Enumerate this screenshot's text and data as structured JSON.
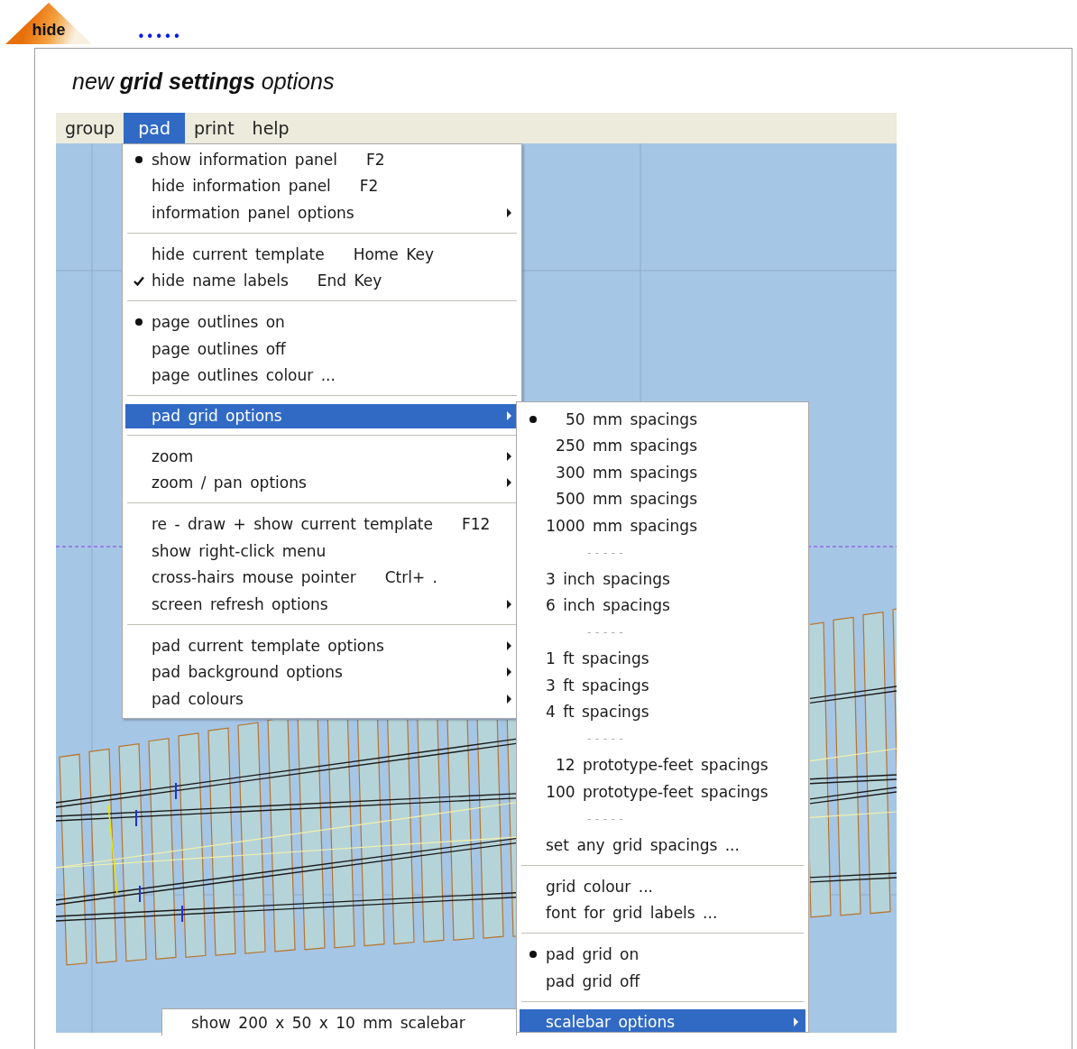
{
  "logo_button": {
    "label": "hide"
  },
  "dots": "•••••",
  "heading": "new **grid settings** options",
  "menubar": [
    {
      "label": "group",
      "selected": false
    },
    {
      "label": "pad",
      "selected": true
    },
    {
      "label": "print",
      "selected": false
    },
    {
      "label": "help",
      "selected": false
    }
  ],
  "pad_menu": {
    "groups": [
      [
        {
          "text": "show information panel",
          "bullet": true,
          "checked": false,
          "shortcut": "F2",
          "submenu": false,
          "selected": false
        },
        {
          "text": "hide information panel",
          "bullet": false,
          "checked": false,
          "shortcut": "F2",
          "submenu": false,
          "selected": false
        },
        {
          "text": "information panel options",
          "bullet": false,
          "checked": false,
          "submenu": true,
          "selected": false
        }
      ],
      [
        {
          "text": "hide current template",
          "bullet": false,
          "checked": false,
          "shortcut": "Home Key",
          "submenu": false,
          "selected": false
        },
        {
          "text": "hide name labels",
          "bullet": false,
          "checked": true,
          "shortcut": "End Key",
          "submenu": false,
          "selected": false
        }
      ],
      [
        {
          "text": "page outlines on",
          "bullet": true,
          "checked": false,
          "submenu": false,
          "selected": false
        },
        {
          "text": "page outlines off",
          "bullet": false,
          "checked": false,
          "submenu": false,
          "selected": false
        },
        {
          "text": "page outlines colour ...",
          "bullet": false,
          "checked": false,
          "submenu": false,
          "selected": false
        }
      ],
      [
        {
          "text": "pad grid options",
          "bullet": false,
          "checked": false,
          "submenu": true,
          "selected": true
        }
      ],
      [
        {
          "text": "zoom",
          "bullet": false,
          "checked": false,
          "submenu": true,
          "selected": false
        },
        {
          "text": "zoom / pan options",
          "bullet": false,
          "checked": false,
          "submenu": true,
          "selected": false
        }
      ],
      [
        {
          "text": "re - draw + show current template",
          "bullet": false,
          "checked": false,
          "shortcut": "F12",
          "submenu": false,
          "selected": false
        },
        {
          "text": "show right-click menu",
          "bullet": false,
          "checked": false,
          "submenu": false,
          "selected": false
        },
        {
          "text": "cross-hairs mouse pointer",
          "bullet": false,
          "checked": false,
          "shortcut": "Ctrl+ .",
          "submenu": false,
          "selected": false
        },
        {
          "text": "screen refresh options",
          "bullet": false,
          "checked": false,
          "submenu": true,
          "selected": false
        }
      ],
      [
        {
          "text": "pad current template options",
          "bullet": false,
          "checked": false,
          "submenu": true,
          "selected": false
        },
        {
          "text": "pad background options",
          "bullet": false,
          "checked": false,
          "submenu": true,
          "selected": false
        },
        {
          "text": "pad colours",
          "bullet": false,
          "checked": false,
          "submenu": true,
          "selected": false
        }
      ]
    ]
  },
  "grid_submenu": [
    {
      "kind": "numbered",
      "number": "50",
      "text": "mm spacings",
      "bullet": true,
      "submenu": false,
      "selected": false
    },
    {
      "kind": "numbered",
      "number": "250",
      "text": "mm spacings",
      "bullet": false,
      "submenu": false,
      "selected": false
    },
    {
      "kind": "numbered",
      "number": "300",
      "text": "mm spacings",
      "bullet": false,
      "submenu": false,
      "selected": false
    },
    {
      "kind": "numbered",
      "number": "500",
      "text": "mm spacings",
      "bullet": false,
      "submenu": false,
      "selected": false
    },
    {
      "kind": "numbered",
      "number": "1000",
      "text": "mm spacings",
      "bullet": false,
      "submenu": false,
      "selected": false
    },
    {
      "kind": "dashes",
      "text": "- - - - -"
    },
    {
      "kind": "item",
      "text": "3 inch spacings",
      "bullet": false,
      "submenu": false,
      "selected": false
    },
    {
      "kind": "item",
      "text": "6 inch spacings",
      "bullet": false,
      "submenu": false,
      "selected": false
    },
    {
      "kind": "dashes",
      "text": "- - - - -"
    },
    {
      "kind": "item",
      "text": "1 ft spacings",
      "bullet": false,
      "submenu": false,
      "selected": false
    },
    {
      "kind": "item",
      "text": "3 ft spacings",
      "bullet": false,
      "submenu": false,
      "selected": false
    },
    {
      "kind": "item",
      "text": "4 ft spacings",
      "bullet": false,
      "submenu": false,
      "selected": false
    },
    {
      "kind": "dashes",
      "text": "- - - - -"
    },
    {
      "kind": "numbered",
      "number": "12",
      "text": "prototype-feet spacings",
      "bullet": false,
      "submenu": false,
      "selected": false
    },
    {
      "kind": "numbered",
      "number": "100",
      "text": "prototype-feet spacings",
      "bullet": false,
      "submenu": false,
      "selected": false
    },
    {
      "kind": "dashes",
      "text": "- - - - -"
    },
    {
      "kind": "item",
      "text": "set any grid spacings ...",
      "bullet": false,
      "submenu": false,
      "selected": false
    },
    {
      "kind": "separator"
    },
    {
      "kind": "item",
      "text": "grid colour ...",
      "bullet": false,
      "submenu": false,
      "selected": false
    },
    {
      "kind": "item",
      "text": "font for grid labels ...",
      "bullet": false,
      "submenu": false,
      "selected": false
    },
    {
      "kind": "separator"
    },
    {
      "kind": "item",
      "text": "pad grid on",
      "bullet": true,
      "submenu": false,
      "selected": false
    },
    {
      "kind": "item",
      "text": "pad grid off",
      "bullet": false,
      "submenu": false,
      "selected": false
    },
    {
      "kind": "separator"
    },
    {
      "kind": "item",
      "text": "scalebar options",
      "bullet": false,
      "submenu": true,
      "selected": true
    }
  ],
  "scalebar_item": {
    "text": "show 200 x 50 x 10 mm scalebar"
  }
}
